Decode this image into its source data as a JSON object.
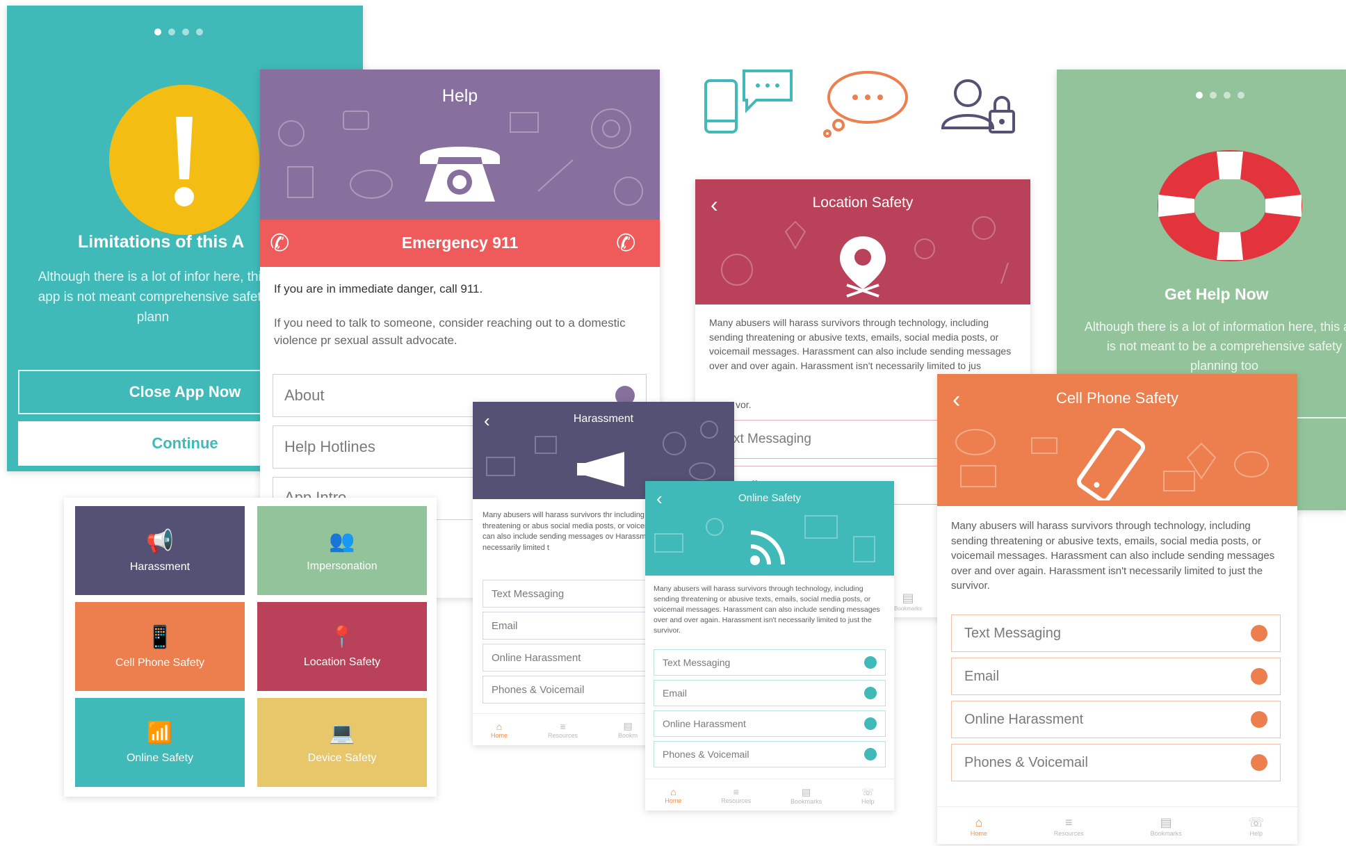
{
  "colors": {
    "teal": "#3fbab8",
    "purple": "#87709e",
    "red": "#ef5a5a",
    "crimson": "#b94159",
    "navy": "#545174",
    "green": "#93c39a",
    "orange": "#ec7f4d",
    "yellow": "#e8c66a",
    "sage": "#8ec29a",
    "text_gray": "#5d5d5d"
  },
  "limitations": {
    "title": "Limitations of this A",
    "body": "Although there is a lot of infor here, this app is not meant comprehensive safety plann",
    "close_label": "Close App Now",
    "continue_label": "Continue"
  },
  "help": {
    "title": "Help",
    "emergency_label": "Emergency 911",
    "danger_text": "If you are in immediate danger, call 911.",
    "advice_text": "If you need to talk to someone, consider reaching out to a domestic violence pr sexual assult advocate.",
    "menu": [
      "About",
      "Help Hotlines",
      "App Intro"
    ]
  },
  "hero_icons": [
    "phone-chat-icon",
    "chat-bubble-icon",
    "user-lock-icon"
  ],
  "location_safety": {
    "title": "Location Safety",
    "body": "Many abusers will harass survivors through technology, including sending threatening or abusive texts, emails, social media posts, or voicemail messages. Harassment can also include sending messages over and over again. Harassment isn't necessarily limited to jus",
    "body_tail": "vor.",
    "rows": [
      "xt Messaging",
      "mail"
    ]
  },
  "get_help": {
    "title": "Get Help Now",
    "body": "Although there is a lot of information here, this app is not meant to be a comprehensive safety planning too"
  },
  "categories": {
    "tiles": [
      {
        "label": "Harassment"
      },
      {
        "label": "Impersonation"
      },
      {
        "label": "Cell Phone Safety"
      },
      {
        "label": "Location Safety"
      },
      {
        "label": "Online Safety"
      },
      {
        "label": "Device Safety"
      }
    ]
  },
  "harassment": {
    "title": "Harassment",
    "body": "Many abusers will harass survivors thr including sending threatening or abus social media posts, or voicemail mess can also include sending messages ov Harassment isn't necessarily limited t",
    "rows": [
      "Text Messaging",
      "Email",
      "Online Harassment",
      "Phones & Voicemail"
    ],
    "tabs": [
      "Home",
      "Resources",
      "Bookm"
    ]
  },
  "online_safety": {
    "title": "Online Safety",
    "body": "Many abusers will harass survivors through technology, including sending threatening or abusive texts, emails, social media posts, or voicemail messages. Harassment can also include sending messages over and over again. Harassment isn't necessarily limited to just the survivor.",
    "rows": [
      "Text Messaging",
      "Email",
      "Online Harassment",
      "Phones & Voicemail"
    ],
    "tabs": [
      "Home",
      "Resources",
      "Bookmarks",
      "Help"
    ]
  },
  "cell_phone": {
    "title": "Cell Phone Safety",
    "body": "Many abusers will harass survivors through technology, including sending threatening or abusive texts, emails, social media posts, or voicemail messages. Harassment can also include sending messages over and over again. Harassment isn't necessarily limited to just the survivor.",
    "rows": [
      "Text Messaging",
      "Email",
      "Online Harassment",
      "Phones & Voicemail"
    ],
    "tabs": [
      "Home",
      "Resources",
      "Bookmarks",
      "Help"
    ]
  },
  "peek_tab": "Bookmarks"
}
